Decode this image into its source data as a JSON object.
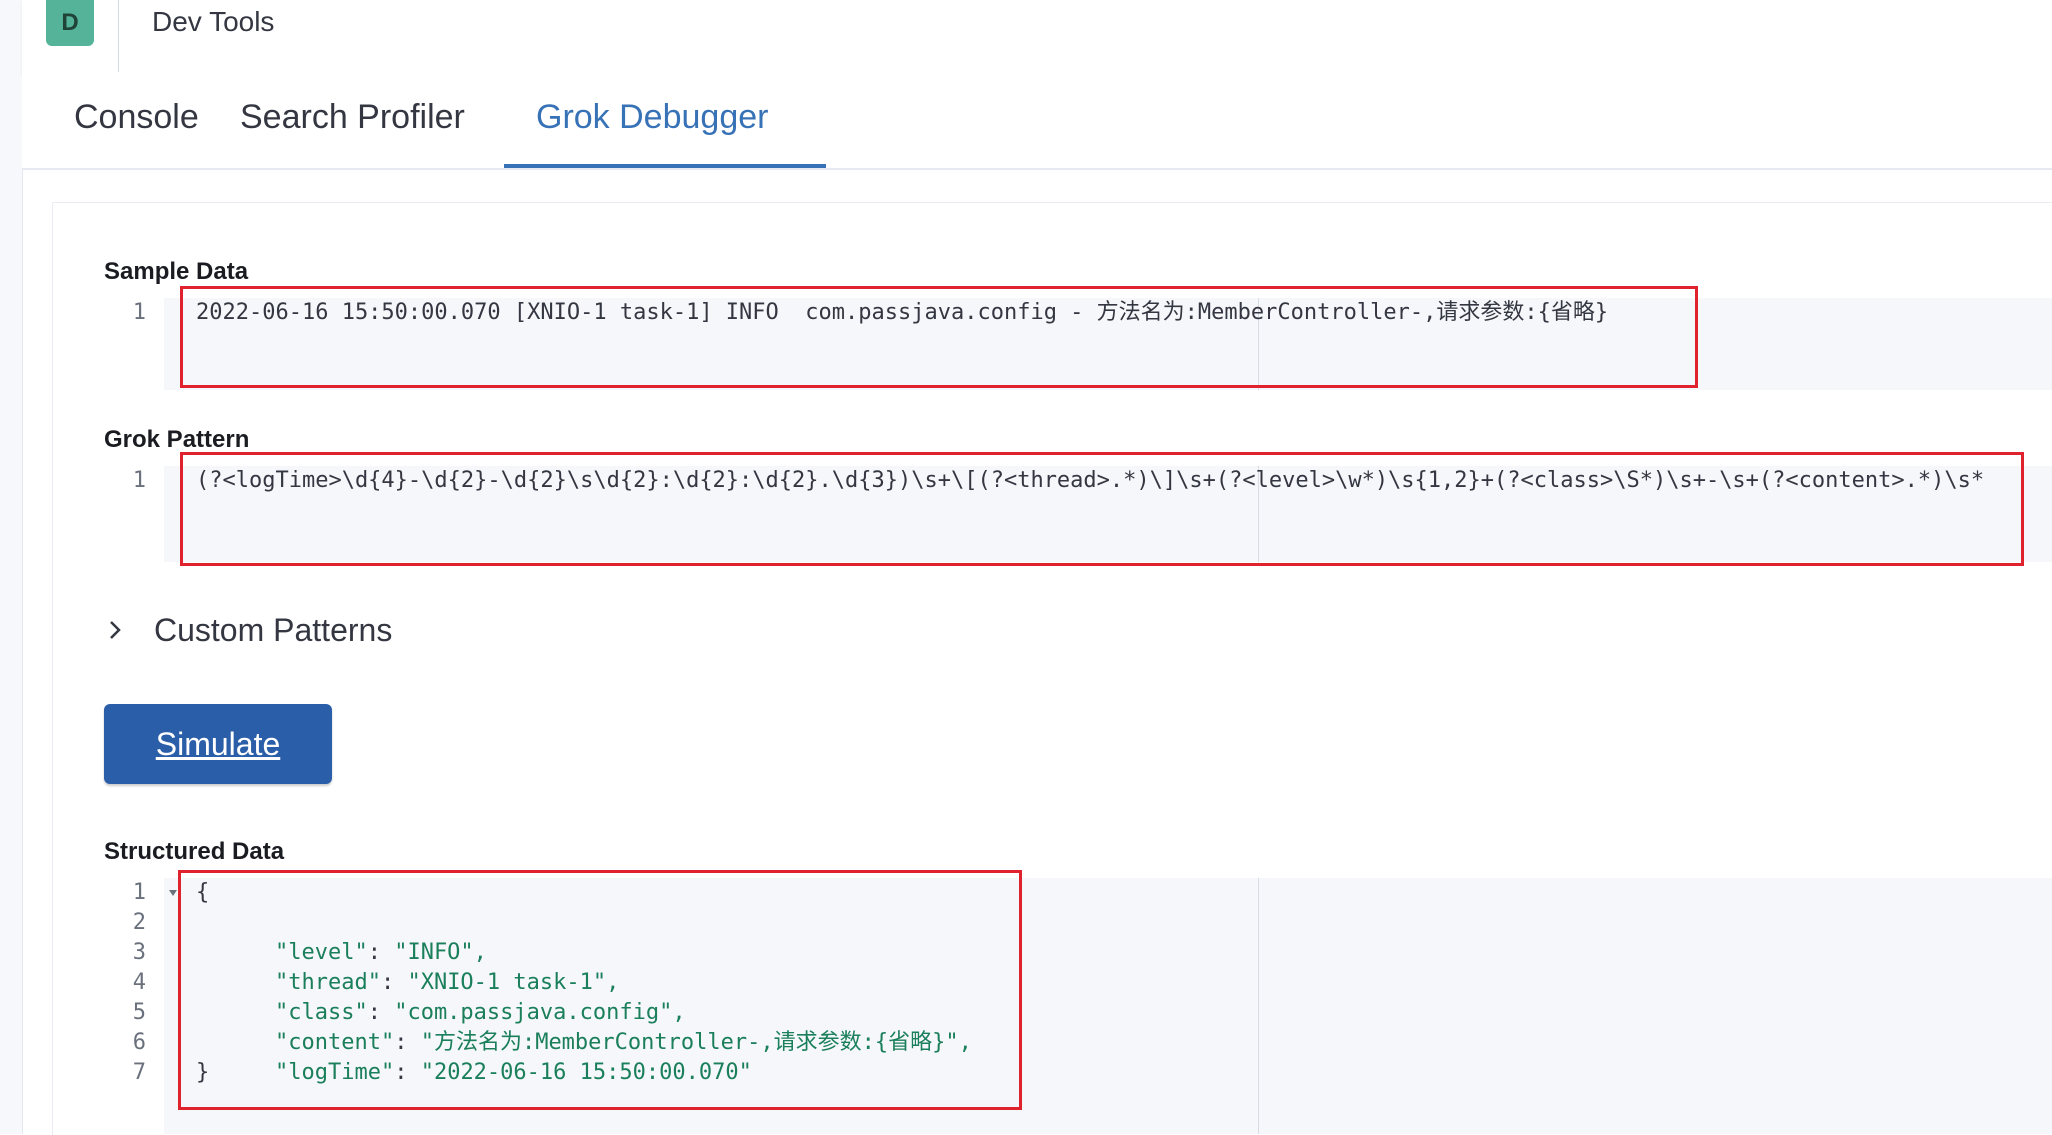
{
  "header": {
    "logo_letter": "D",
    "app_title": "Dev Tools"
  },
  "tabs": [
    {
      "label": "Console",
      "active": false
    },
    {
      "label": "Search Profiler",
      "active": false
    },
    {
      "label": "Grok Debugger",
      "active": true
    }
  ],
  "sample_data": {
    "label": "Sample Data",
    "line_numbers": [
      "1"
    ],
    "lines": [
      "2022-06-16 15:50:00.070 [XNIO-1 task-1] INFO  com.passjava.config - 方法名为:MemberController-,请求参数:{省略}"
    ]
  },
  "grok_pattern": {
    "label": "Grok Pattern",
    "line_numbers": [
      "1"
    ],
    "lines": [
      "(?<logTime>\\d{4}-\\d{2}-\\d{2}\\s\\d{2}:\\d{2}:\\d{2}.\\d{3})\\s+\\[(?<thread>.*)\\]\\s+(?<level>\\w*)\\s{1,2}+(?<class>\\S*)\\s+-\\s+(?<content>.*)\\s*"
    ]
  },
  "custom_patterns": {
    "label": "Custom Patterns",
    "expanded": false
  },
  "simulate_button": {
    "label": "Simulate"
  },
  "structured_data": {
    "label": "Structured Data",
    "line_numbers": [
      "1",
      "2",
      "3",
      "4",
      "5",
      "6",
      "7"
    ],
    "open_brace": "{",
    "close_brace": "}",
    "fields": [
      {
        "key": "\"level\"",
        "value": "\"INFO\","
      },
      {
        "key": "\"thread\"",
        "value": "\"XNIO-1 task-1\","
      },
      {
        "key": "\"class\"",
        "value": "\"com.passjava.config\","
      },
      {
        "key": "\"content\"",
        "value": "\"方法名为:MemberController-,请求参数:{省略}\","
      },
      {
        "key": "\"logTime\"",
        "value": "\"2022-06-16 15:50:00.070\""
      }
    ]
  },
  "colors": {
    "accent": "#3772b7",
    "button": "#2a5ea8",
    "highlight_box": "#e0212e",
    "logo": "#54b399"
  }
}
